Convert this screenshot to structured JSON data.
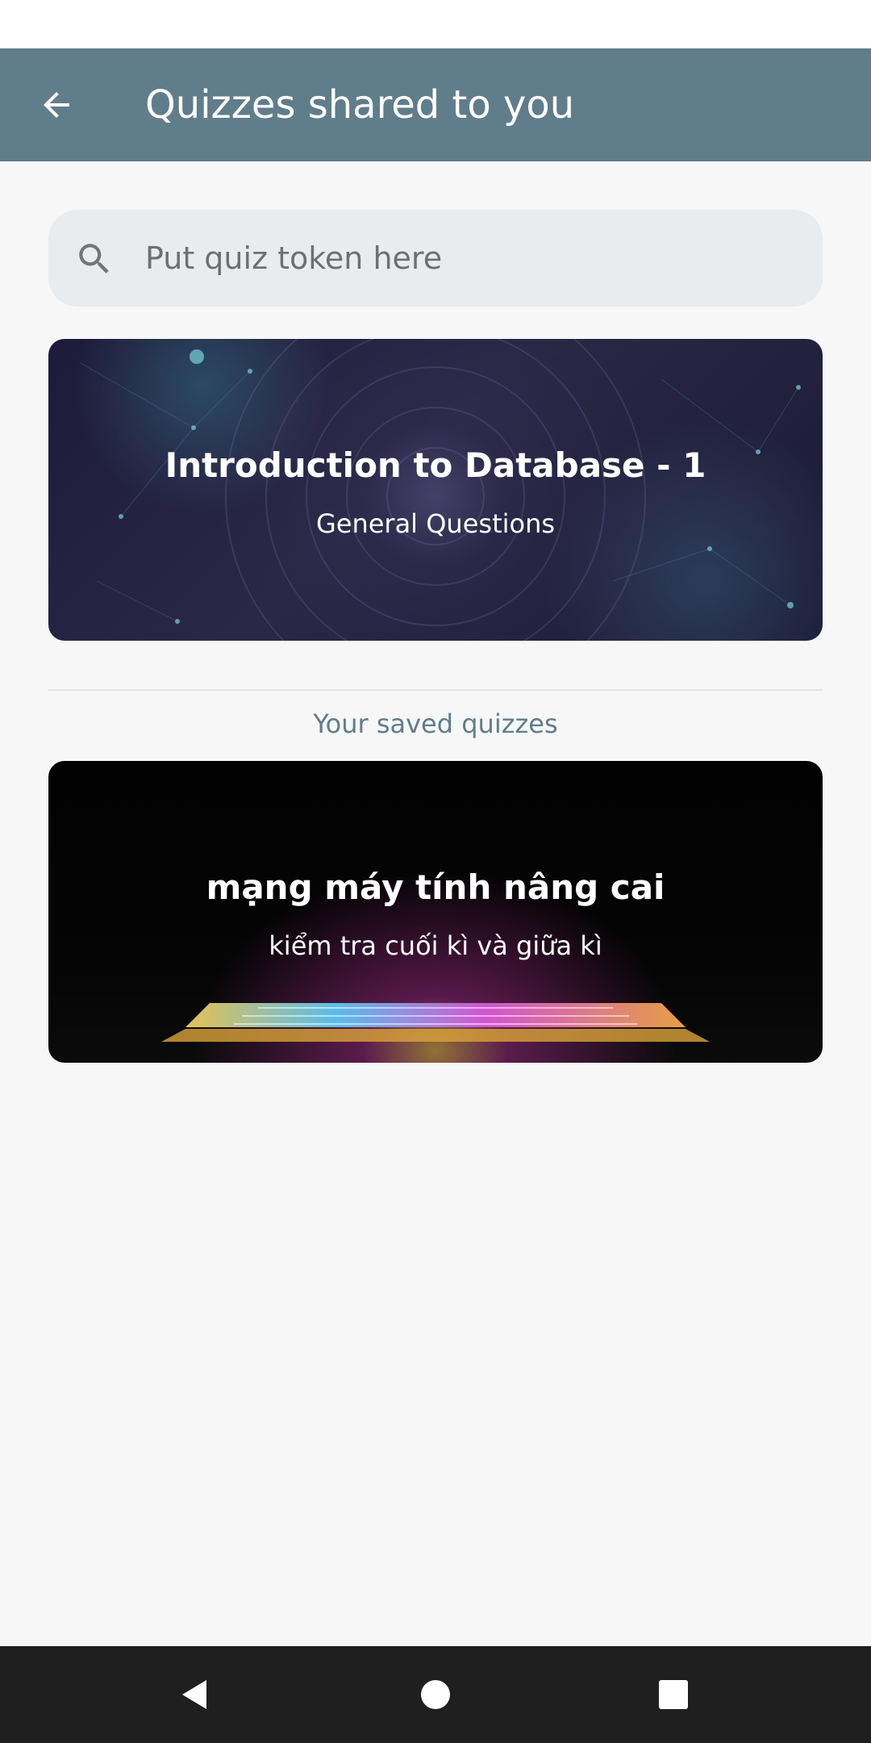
{
  "header": {
    "title": "Quizzes shared to you",
    "back_icon": "arrow-back-icon",
    "background_color": "#607d8b"
  },
  "search": {
    "placeholder": "Put quiz token here",
    "value": "",
    "icon": "search-icon"
  },
  "shared_quizzes": [
    {
      "title": "Introduction to Database - 1",
      "subtitle": "General Questions"
    }
  ],
  "saved_section": {
    "heading": "Your saved quizzes",
    "quizzes": [
      {
        "title": "mạng máy tính nâng cai",
        "subtitle": "kiểm tra cuối kì và giữa kì"
      }
    ]
  },
  "nav_bar": {
    "icons": [
      "nav-back-icon",
      "nav-home-icon",
      "nav-recents-icon"
    ]
  }
}
